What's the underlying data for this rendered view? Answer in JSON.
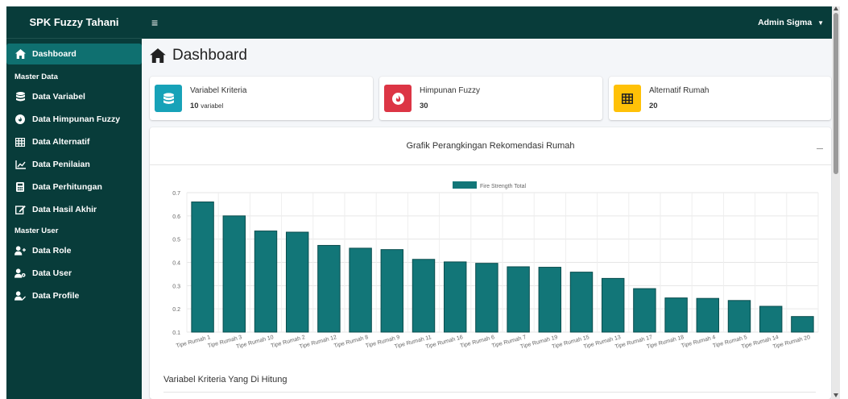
{
  "sidebar": {
    "brand": "SPK Fuzzy Tahani",
    "active_item": "Dashboard",
    "section_master_data": "Master Data",
    "items_master_data": [
      "Data Variabel",
      "Data Himpunan Fuzzy",
      "Data Alternatif",
      "Data Penilaian",
      "Data Perhitungan",
      "Data Hasil Akhir"
    ],
    "section_master_user": "Master User",
    "items_master_user": [
      "Data Role",
      "Data User",
      "Data Profile"
    ]
  },
  "topbar": {
    "user": "Admin Sigma"
  },
  "page": {
    "title": "Dashboard"
  },
  "info_boxes": [
    {
      "label": "Variabel Kriteria",
      "value": "10",
      "unit": "variabel",
      "color": "#17a2b8",
      "icon": "database-icon"
    },
    {
      "label": "Himpunan Fuzzy",
      "value": "30",
      "unit": "",
      "color": "#dc3545",
      "icon": "fire-icon"
    },
    {
      "label": "Alternatif Rumah",
      "value": "20",
      "unit": "",
      "color": "#ffc107",
      "icon": "table-icon"
    }
  ],
  "chart_card": {
    "title": "Grafik Perangkingan Rekomendasi Rumah",
    "sub_title": "Variabel Kriteria Yang Di Hitung"
  },
  "chart_data": {
    "type": "bar",
    "categories": [
      "Tipe Rumah 1",
      "Tipe Rumah 3",
      "Tipe Rumah 10",
      "Tipe Rumah 2",
      "Tipe Rumah 12",
      "Tipe Rumah 8",
      "Tipe Rumah 9",
      "Tipe Rumah 11",
      "Tipe Rumah 16",
      "Tipe Rumah 6",
      "Tipe Rumah 7",
      "Tipe Rumah 19",
      "Tipe Rumah 15",
      "Tipe Rumah 13",
      "Tipe Rumah 17",
      "Tipe Rumah 18",
      "Tipe Rumah 4",
      "Tipe Rumah 5",
      "Tipe Rumah 14",
      "Tipe Rumah 20"
    ],
    "series": [
      {
        "name": "Fire Strength Total",
        "values": [
          0.66,
          0.6,
          0.535,
          0.53,
          0.473,
          0.461,
          0.455,
          0.413,
          0.402,
          0.396,
          0.381,
          0.379,
          0.358,
          0.331,
          0.287,
          0.247,
          0.245,
          0.236,
          0.211,
          0.167
        ]
      }
    ],
    "yticks": [
      "0.1",
      "0.2",
      "0.3",
      "0.4",
      "0.5",
      "0.6",
      "0.7"
    ],
    "ylim": [
      0.1,
      0.7
    ],
    "bar_color": "#127678",
    "grid": true,
    "legend": "top-center"
  }
}
